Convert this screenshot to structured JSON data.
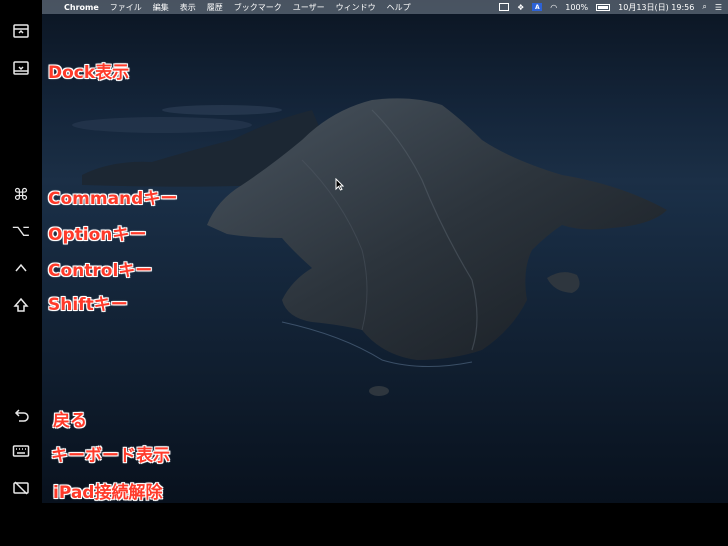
{
  "menubar": {
    "app": "Chrome",
    "items": [
      "ファイル",
      "編集",
      "表示",
      "履歴",
      "ブックマーク",
      "ユーザー",
      "ウィンドウ",
      "ヘルプ"
    ],
    "status": {
      "keyboard_badge": "A",
      "battery": "100%",
      "datetime": "10月13日(日)  19:56"
    }
  },
  "sidebar_labels": {
    "dock": "Dock表示",
    "command": "Commandキー",
    "option": "Optionキー",
    "control": "Controlキー",
    "shift": "Shiftキー",
    "back": "戻る",
    "keyboard": "キーボード表示",
    "disconnect": "iPad接続解除"
  },
  "colors": {
    "label": "#ff3a2a",
    "sidebar_bg": "#000000"
  },
  "icons": {
    "command": "⌘",
    "option": "⌥",
    "control": "^",
    "shift": "⇧"
  }
}
